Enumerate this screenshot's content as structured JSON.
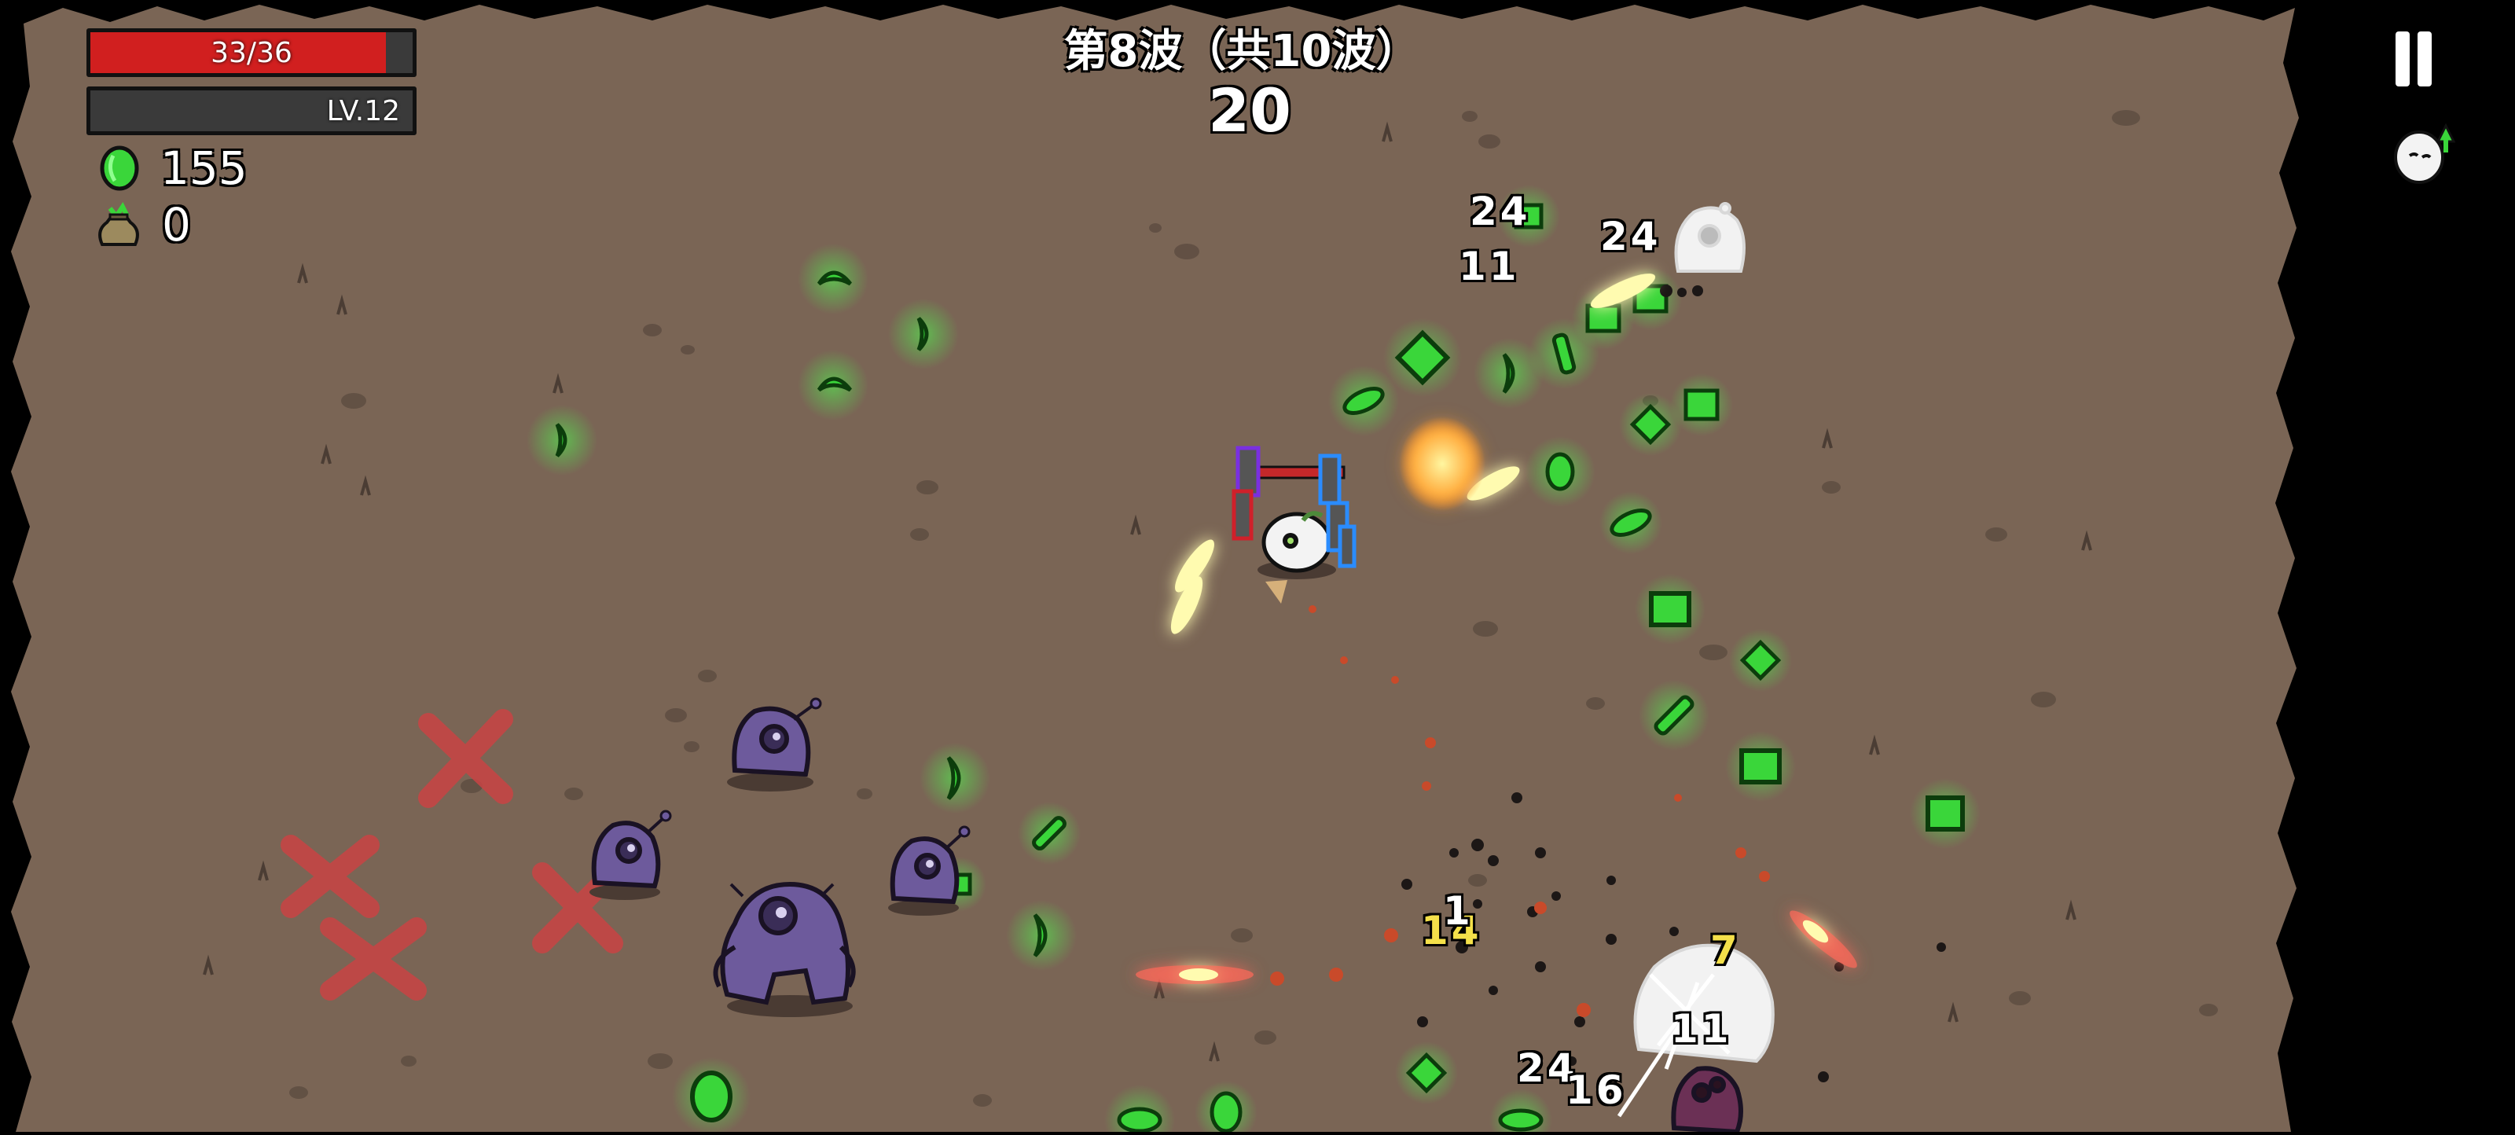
{
  "hud": {
    "hp_text": "33/36",
    "hp_current": 33,
    "hp_max": 36,
    "level_text": "LV.12",
    "xp_fraction": 0.0,
    "materials_count": "155",
    "bag_count": "0",
    "material_icon": "green-material-icon",
    "bag_icon": "money-bag-icon"
  },
  "wave": {
    "title": "第8波（共10波）",
    "timer": "20"
  },
  "controls": {
    "pause_icon": "pause-icon",
    "levelup_icon": "level-up-indicator-icon"
  },
  "damage_numbers": [
    "24",
    "11",
    "24",
    "14",
    "1",
    "7",
    "11",
    "24",
    "16"
  ],
  "colors": {
    "ground": "#7a6555",
    "hp_fill": "#d11f1f",
    "material_green": "#3ad63a",
    "enemy_purple": "#6d5a9c",
    "crit_yellow": "#f4e04a"
  }
}
